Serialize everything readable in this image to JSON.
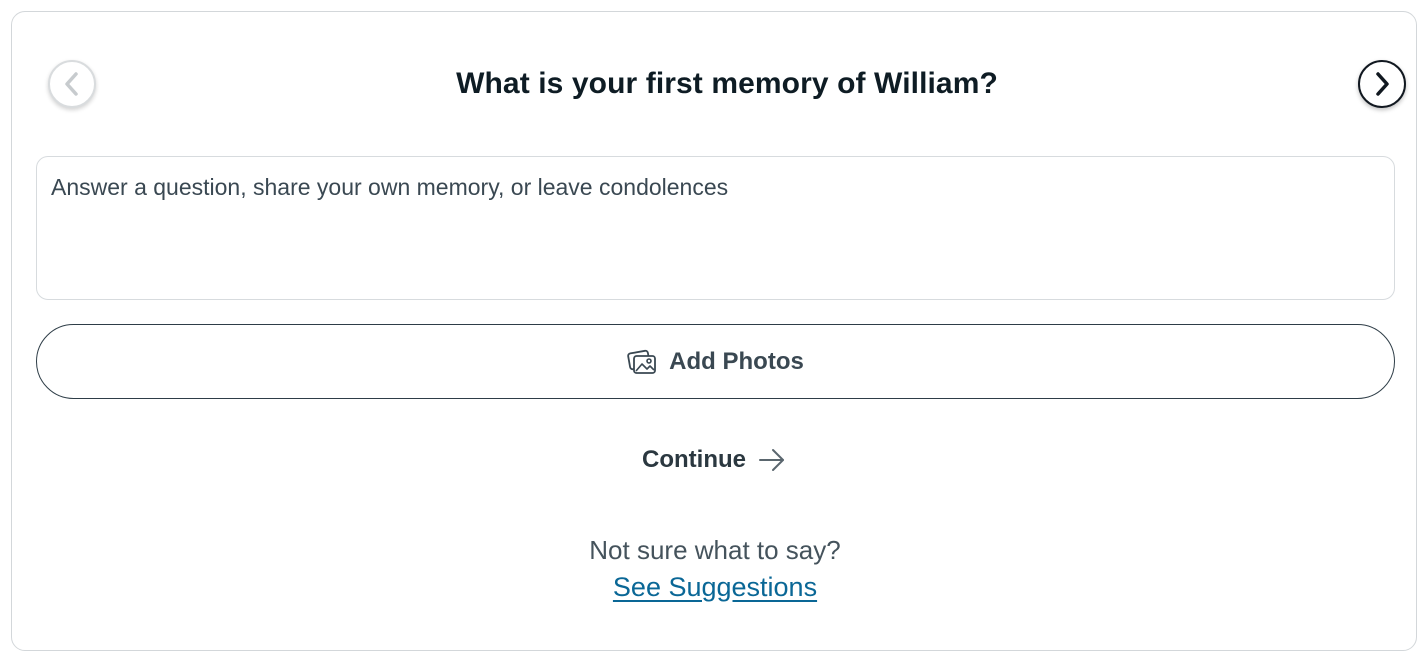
{
  "prompt": {
    "question": "What is your first memory of William?"
  },
  "navigation": {
    "prev_icon": "chevron-left-icon",
    "next_icon": "chevron-right-icon"
  },
  "memory_input": {
    "value": "",
    "placeholder": "Answer a question, share your own memory, or leave condolences"
  },
  "add_photos": {
    "label": "Add Photos",
    "icon": "photos-icon"
  },
  "continue": {
    "label": "Continue",
    "icon": "arrow-right-icon"
  },
  "suggestions": {
    "hint": "Not sure what to say?",
    "link_label": "See Suggestions"
  },
  "colors": {
    "link": "#0a6796",
    "text_dark": "#0e1c24",
    "border": "#d7dbde"
  }
}
